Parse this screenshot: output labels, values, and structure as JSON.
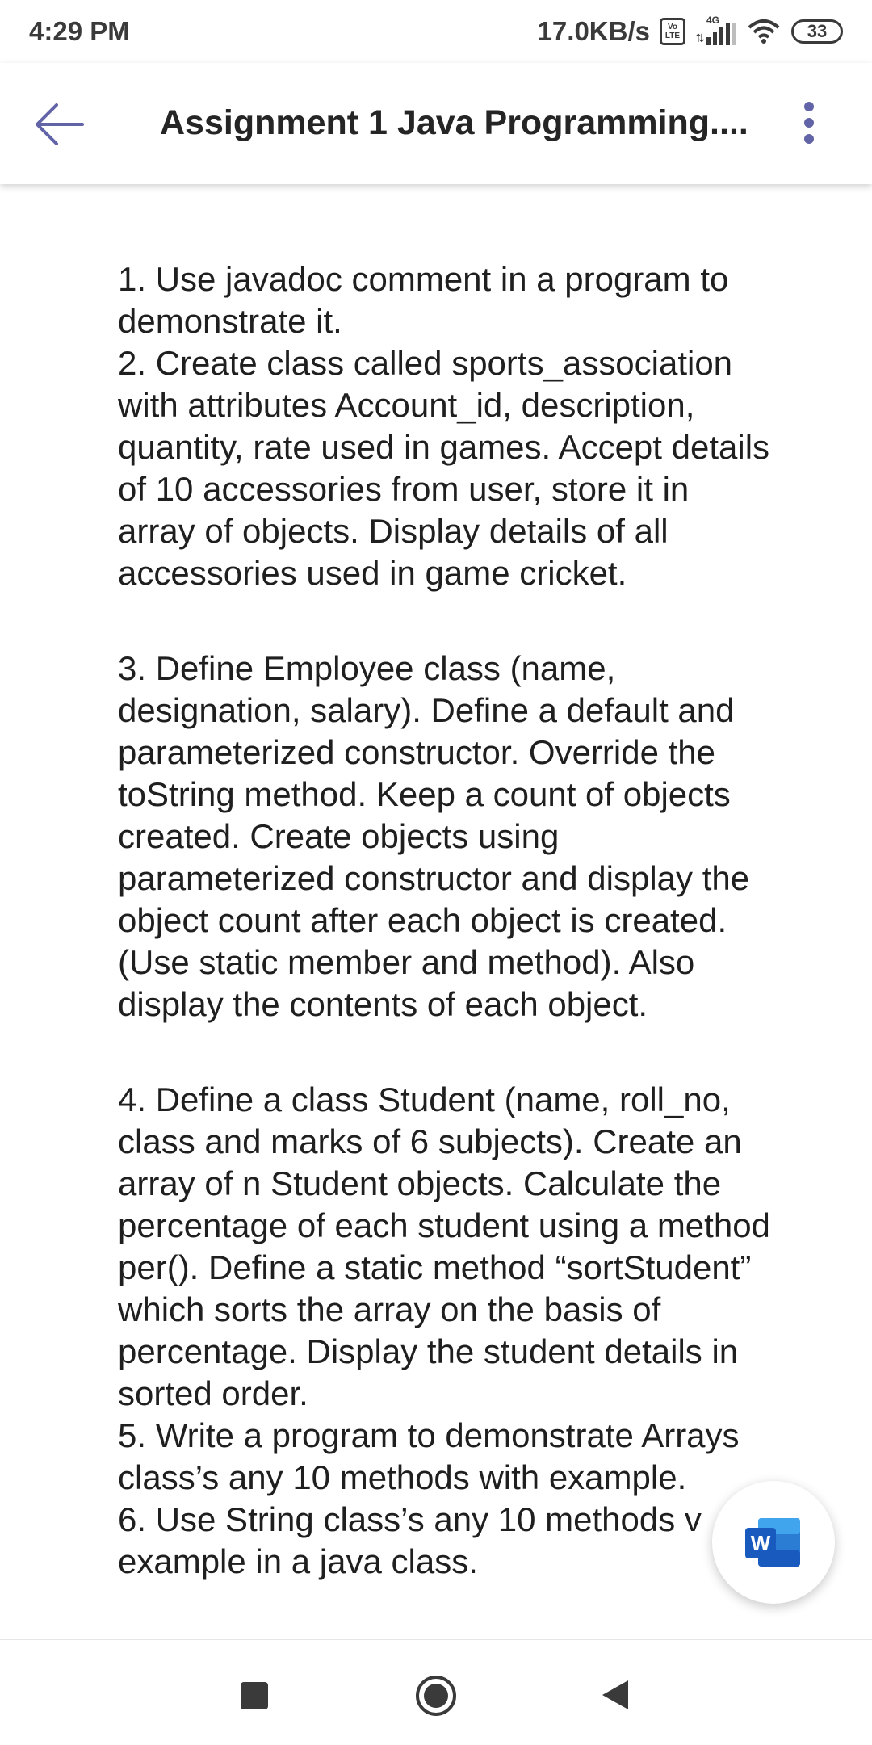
{
  "status_bar": {
    "time": "4:29 PM",
    "net_speed": "17.0KB/s",
    "volte_top": "Vo",
    "volte_bottom": "LTE",
    "network_type": "4G",
    "battery": "33"
  },
  "app_bar": {
    "title": "Assignment 1 Java Programming....",
    "back_icon": "arrow-left-icon",
    "more_icon": "more-vertical-icon",
    "accent_color": "#6264a7"
  },
  "document": {
    "block_1": "1. Use javadoc comment in a program to\ndemonstrate it.\n2. Create class called sports_association\nwith attributes Account_id, description,\nquantity, rate used in games. Accept details\nof 10 accessories from user, store it in\narray of objects. Display details of all\naccessories used in game cricket.",
    "block_2": "3. Define Employee class (name,\ndesignation, salary). Define a default and\nparameterized constructor. Override the\ntoString method. Keep a count of objects\ncreated. Create objects using\nparameterized constructor and display the\nobject count after each object is created.\n(Use static member and method). Also\ndisplay the contents of each object.",
    "block_3": "4. Define a class Student (name, roll_no,\nclass and marks of 6 subjects). Create an\narray of n Student objects. Calculate the\npercentage of each student using a method\nper(). Define a static method “sortStudent”\nwhich sorts the array on the basis of\npercentage. Display the student details in\nsorted order.\n5. Write a program to demonstrate Arrays\nclass’s any 10 methods with example.\n6. Use String class’s any 10 methods v\nexample in a java class."
  },
  "fab": {
    "icon": "microsoft-word-icon",
    "letter": "W"
  },
  "nav_bar": {
    "icons": [
      "recents-square-icon",
      "home-circle-icon",
      "back-triangle-icon"
    ]
  }
}
